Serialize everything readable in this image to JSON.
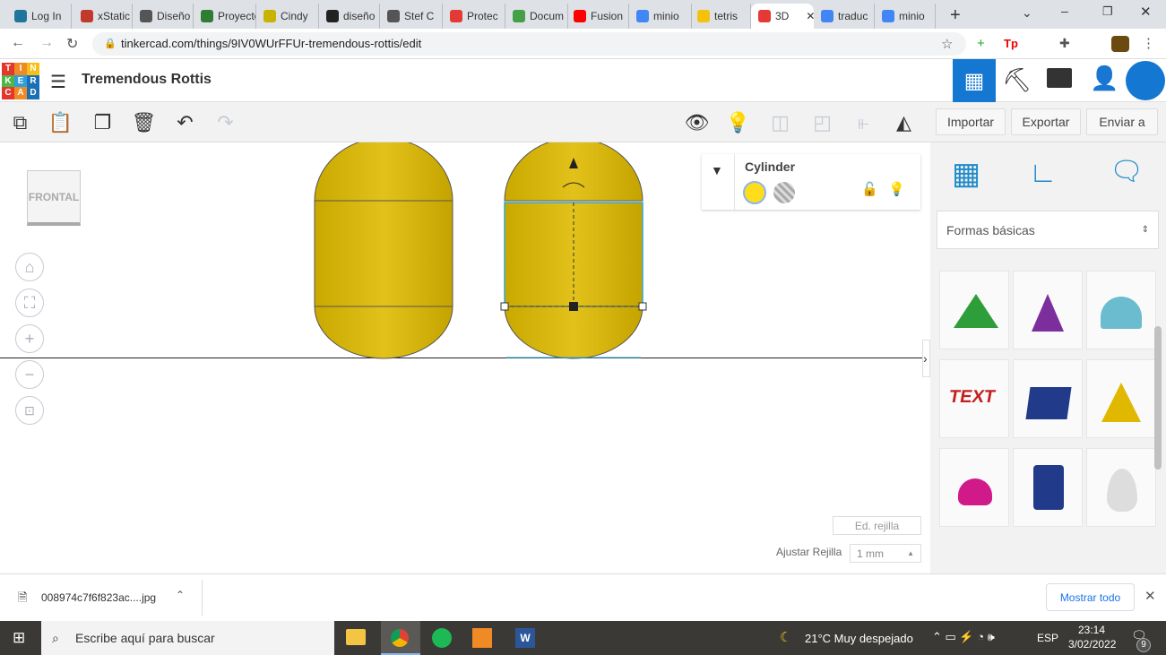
{
  "browser": {
    "tabs": [
      {
        "label": "Log In",
        "icon": "wordpress-icon",
        "color": "#21759b"
      },
      {
        "label": "xStatic",
        "icon": "xstatic-icon",
        "color": "#c0392b"
      },
      {
        "label": "Diseño",
        "icon": "book-icon",
        "color": "#555"
      },
      {
        "label": "Proyecto",
        "icon": "leaf-icon",
        "color": "#2e7d32"
      },
      {
        "label": "Cindy",
        "icon": "cindy-icon",
        "color": "#c8b400"
      },
      {
        "label": "diseño",
        "icon": "triangle-icon",
        "color": "#222"
      },
      {
        "label": "Stef C",
        "icon": "globe-icon",
        "color": "#555"
      },
      {
        "label": "Protec",
        "icon": "bug-icon",
        "color": "#e53935"
      },
      {
        "label": "Docum",
        "icon": "gear-icon",
        "color": "#43a047"
      },
      {
        "label": "Fusion",
        "icon": "youtube-icon",
        "color": "#ff0000"
      },
      {
        "label": "minio",
        "icon": "google-icon",
        "color": "#4285f4"
      },
      {
        "label": "tetris",
        "icon": "tetris-icon",
        "color": "#f4c20d"
      },
      {
        "label": "3D",
        "icon": "tinkercad-icon",
        "color": "#e53935"
      },
      {
        "label": "traduc",
        "icon": "google-icon",
        "color": "#4285f4"
      },
      {
        "label": "minio",
        "icon": "google-icon",
        "color": "#4285f4"
      }
    ],
    "active_tab": 12,
    "url": "tinkercad.com/things/9IV0WUrFFUr-tremendous-rottis/edit"
  },
  "app": {
    "logo_letters": [
      "T",
      "I",
      "N",
      "K",
      "E",
      "R",
      "C",
      "A",
      "D"
    ],
    "title": "Tremendous Rottis",
    "accent": "#1477d1"
  },
  "toolbar": {
    "import": "Importar",
    "export": "Exportar",
    "send": "Enviar a"
  },
  "viewcube": {
    "label": "FRONTAL"
  },
  "inspector": {
    "shape_name": "Cylinder",
    "solid_color": "#ffdd1b"
  },
  "panel": {
    "category": "Formas básicas"
  },
  "grid": {
    "edit_label": "Ed. rejilla",
    "snap_label": "Ajustar Rejilla",
    "snap_value": "1 mm"
  },
  "download": {
    "file": "008974c7f6f823ac....jpg",
    "show_all": "Mostrar todo"
  },
  "taskbar": {
    "search": "Escribe aquí para buscar",
    "weather": "21°C  Muy despejado",
    "lang": "ESP",
    "time": "23:14",
    "date": "3/02/2022",
    "notifications": "9"
  }
}
